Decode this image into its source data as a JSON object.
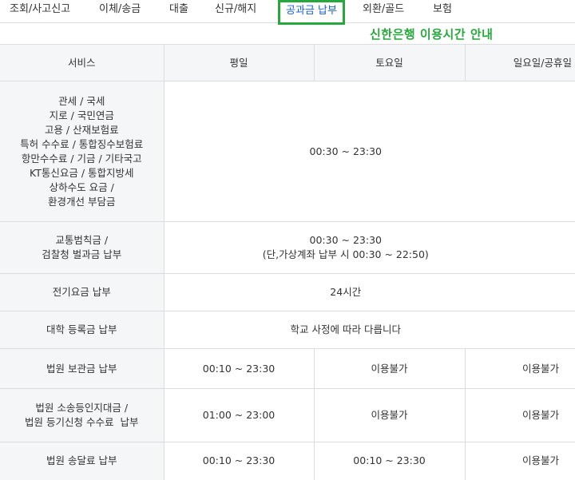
{
  "tabs": [
    {
      "label": "조회/사고신고",
      "active": false
    },
    {
      "label": "이체/송금",
      "active": false
    },
    {
      "label": "대출",
      "active": false
    },
    {
      "label": "신규/해지",
      "active": false
    },
    {
      "label": "공과금 납부",
      "active": true
    },
    {
      "label": "외환/골드",
      "active": false
    },
    {
      "label": "보험",
      "active": false
    }
  ],
  "notice": "신한은행 이용시간 안내",
  "colors": {
    "accent_green": "#27a83d",
    "header_bg": "#f5f6f8",
    "border": "#dcdcdc"
  },
  "table": {
    "headers": [
      "서비스",
      "평일",
      "토요일",
      "일요일/공휴일"
    ],
    "rows": [
      {
        "service_lines": [
          "관세 / 국세",
          "지로 / 국민연금",
          "고용 / 산재보험료",
          "특허 수수료 / 통합징수보험료",
          "항만수수료 / 기금 / 기타국고",
          "KT통신요금 / 통합지방세",
          "상하수도 요금 /",
          "환경개선 부담금"
        ],
        "merged": "00:30 ~ 23:30"
      },
      {
        "service_lines": [
          "교통범칙금 /",
          "검찰청 벌과금 납부"
        ],
        "merged_lines": [
          "00:30 ~ 23:30",
          "(단,가상계좌 납부 시 00:30 ~ 22:50)"
        ]
      },
      {
        "service_lines": [
          "전기요금 납부"
        ],
        "merged": "24시간"
      },
      {
        "service_lines": [
          "대학 등록금 납부"
        ],
        "merged": "학교 사정에 따라 다릅니다"
      },
      {
        "service_lines": [
          "법원 보관금 납부"
        ],
        "weekday": "00:10 ~ 23:30",
        "saturday": "이용불가",
        "sunday": "이용불가"
      },
      {
        "service_lines": [
          "법원 소송등인지대금 /",
          "법원 등기신청 수수료  납부"
        ],
        "weekday": "01:00 ~ 23:00",
        "saturday": "이용불가",
        "sunday": "이용불가"
      },
      {
        "service_lines": [
          "법원 송달료 납부"
        ],
        "weekday": "00:10 ~ 23:30",
        "saturday": "00:10 ~ 23:30",
        "sunday": "이용불가"
      }
    ]
  }
}
